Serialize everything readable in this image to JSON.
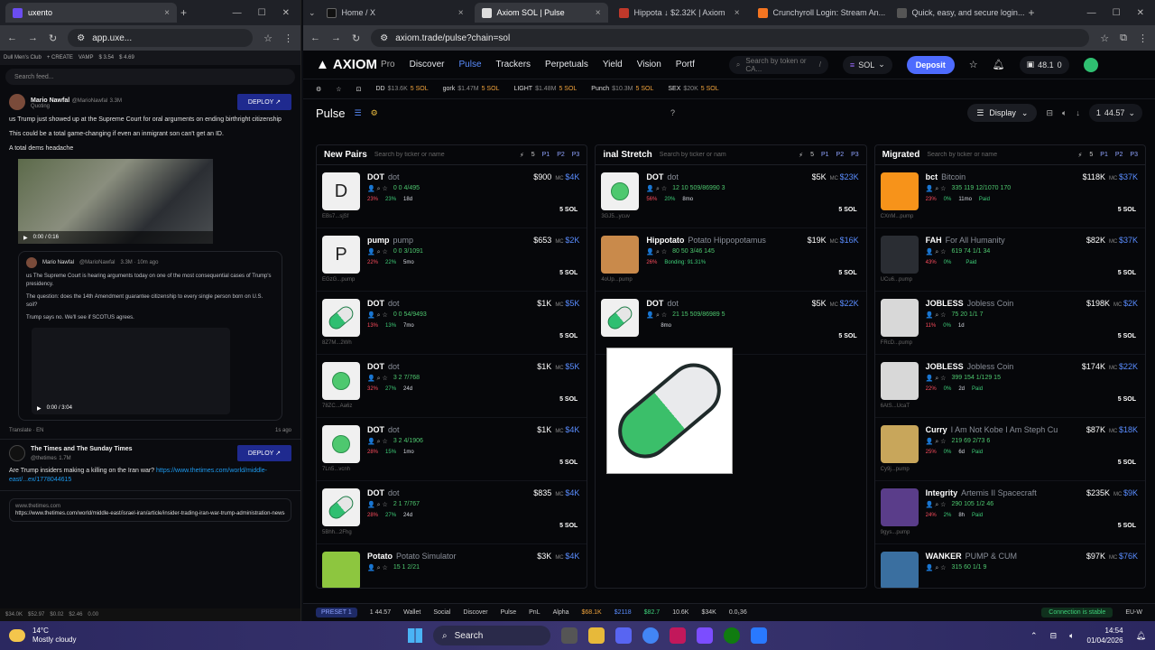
{
  "left_window": {
    "tab_title": "uxento",
    "address": "app.uxe...",
    "search_placeholder": "Search feed...",
    "toolbar_items": [
      "Dull Men's Club",
      "+ CREATE",
      "VAMP",
      "$ 3.54",
      "$ 4.69"
    ],
    "posts": [
      {
        "author": "Mario Nawfal",
        "handle": "@MarioNawfal",
        "meta": "3.3M",
        "sub": "Quoting",
        "deploy_label": "DEPLOY",
        "text": "us Trump just showed up at the Supreme Court for oral arguments on ending birthright citizenship",
        "text2": "This could be a total game-changing if even an inmigrant son can't get an ID.",
        "text3": "A total dems headache",
        "video_time": "0:00 / 0:16",
        "quote": {
          "author": "Mario Nawfal",
          "handle": "@MarioNawfal",
          "meta": "3.3M · 10m ago",
          "text1": "us The Supreme Court is hearing arguments today on one of the most consequential cases of Trump's presidency.",
          "text2": "The question: does the 14th Amendment guarantee citizenship to every single person born on U.S. soil?",
          "text3": "Trump says no. We'll see if SCOTUS agrees.",
          "video_time": "0:00 / 3:04"
        },
        "translate": "Translate · EN",
        "ago": "1s ago"
      },
      {
        "author": "The Times and The Sunday Times",
        "handle": "@thetimes",
        "meta": "1.7M",
        "deploy_label": "DEPLOY",
        "text": "Are Trump insiders making a killing on the Iran war?",
        "link": "https://www.thetimes.com/world/middle-east/...ex/1778044615",
        "card_domain": "www.thetimes.com",
        "card_url": "https://www.thetimes.com/world/middle-east/israel-iran/article/insider-trading-iran-war-trump-administration-news-7rn3tpjw?..."
      }
    ],
    "status": [
      "$34.0K",
      "$52.97",
      "$0.02",
      "$2.46",
      "0.00"
    ]
  },
  "right_window": {
    "tabs": [
      {
        "title": "Home / X",
        "color": "#111111"
      },
      {
        "title": "Axiom SOL | Pulse",
        "color": "#222222",
        "active": true
      },
      {
        "title": "Hippota ↓ $2.32K | Axiom",
        "color": "#c0392b"
      },
      {
        "title": "Crunchyroll Login: Stream An...",
        "color": "#f47521"
      },
      {
        "title": "Quick, easy, and secure login...",
        "color": "#555555"
      }
    ],
    "address": "axiom.trade/pulse?chain=sol",
    "nav": {
      "logo": "AXIOM",
      "logo_sub": "Pro",
      "items": [
        "Discover",
        "Pulse",
        "Trackers",
        "Perpetuals",
        "Yield",
        "Vision",
        "Portf"
      ],
      "search_placeholder": "Search by token or CA...",
      "search_key": "/",
      "chain": "SOL",
      "deposit": "Deposit",
      "balance": "48.1",
      "count": "0"
    },
    "ticker": [
      {
        "sym": "DD",
        "cap": "$13.6K",
        "amt": "5 SOL"
      },
      {
        "sym": "gork",
        "cap": "$1.47M",
        "amt": "5 SOL"
      },
      {
        "sym": "LIGHT",
        "cap": "$1.48M",
        "amt": "5 SOL"
      },
      {
        "sym": "Punch",
        "cap": "$10.3M",
        "amt": "5 SOL"
      },
      {
        "sym": "SEX",
        "cap": "$20K",
        "amt": "5 SOL"
      }
    ],
    "pulse_title": "Pulse",
    "display_label": "Display",
    "page_info": "1",
    "sol_amount": "44.57",
    "columns": [
      {
        "title": "New Pairs",
        "search": "Search by ticker or name",
        "count": "5",
        "rows": [
          {
            "sym": "DOT",
            "name": "dot",
            "thumb": "D",
            "id": "EBs7...sjSf",
            "vol": "$900",
            "mc": "$4K",
            "stats": "0  0  4/495",
            "p1": "23%",
            "p2": "23%",
            "age": "18d",
            "sol": "5 SOL"
          },
          {
            "sym": "pump",
            "name": "pump",
            "thumb": "P",
            "id": "EGzG...pump",
            "vol": "$653",
            "mc": "$2K",
            "stats": "0  0  3/1091",
            "p1": "22%",
            "p2": "22%",
            "age": "5mo",
            "sol": "5 SOL"
          },
          {
            "sym": "DOT",
            "name": "dot",
            "thumb": "pill",
            "id": "8Z7M...2Wh",
            "vol": "$1K",
            "mc": "$5K",
            "stats": "0  0  54/9493",
            "p1": "13%",
            "p2": "13%",
            "age": "7mo",
            "sol": "5 SOL"
          },
          {
            "sym": "DOT",
            "name": "dot",
            "thumb": "circle",
            "id": "78ZC...Aa6z",
            "vol": "$1K",
            "mc": "$5K",
            "stats": "3  2  7/768",
            "p1": "32%",
            "p2": "27%",
            "age": "24d",
            "sol": "5 SOL"
          },
          {
            "sym": "DOT",
            "name": "dot",
            "thumb": "circle",
            "id": "7Ln5...vcnh",
            "vol": "$1K",
            "mc": "$4K",
            "stats": "3  2  4/1906",
            "p1": "28%",
            "p2": "15%",
            "age": "1mo",
            "sol": "5 SOL"
          },
          {
            "sym": "DOT",
            "name": "dot",
            "thumb": "pill",
            "id": "5Bhh...2Fhg",
            "vol": "$835",
            "mc": "$4K",
            "stats": "2  1  7/767",
            "p1": "28%",
            "p2": "27%",
            "age": "24d",
            "sol": "5 SOL"
          },
          {
            "sym": "Potato",
            "name": "Potato Simulator",
            "thumb": "potato",
            "id": "",
            "vol": "$3K",
            "mc": "$4K",
            "stats": "15  1  2/21",
            "p1": "",
            "p2": "",
            "age": "",
            "sol": ""
          }
        ]
      },
      {
        "title": "inal Stretch",
        "search": "Search by ticker or nam",
        "count": "5",
        "rows": [
          {
            "sym": "DOT",
            "name": "dot",
            "thumb": "circle",
            "id": "3GJ5...ycuv",
            "vol": "$5K",
            "mc": "$23K",
            "stats": "12  10  509/86990  3",
            "p1": "56%",
            "p2": "20%",
            "age": "8mo",
            "sol": "5 SOL"
          },
          {
            "sym": "Hippotato",
            "name": "Potato Hippopotamus",
            "thumb": "hippo",
            "id": "4oUp...pump",
            "vol": "$19K",
            "mc": "$16K",
            "stats": "80  50  3/46  145",
            "p1": "26%",
            "p2": "Bonding: 91.31%",
            "age": "",
            "sol": "5 SOL"
          },
          {
            "sym": "DOT",
            "name": "dot",
            "thumb": "pill",
            "id": "",
            "vol": "$5K",
            "mc": "$22K",
            "stats": "21  15  509/86989  5",
            "p1": "",
            "p2": "",
            "age": "8mo",
            "sol": "5 SOL"
          }
        ]
      },
      {
        "title": "Migrated",
        "search": "Search by ticker or name",
        "count": "5",
        "rows": [
          {
            "sym": "bct",
            "name": "Bitcoin",
            "thumb": "btc",
            "id": "CXnM...pump",
            "vol": "$118K",
            "mc": "$37K",
            "stats": "335  119  12/1070  170",
            "p1": "23%",
            "p2": "0%",
            "age": "11mo",
            "paid": "Paid",
            "sol": "5 SOL"
          },
          {
            "sym": "FAH",
            "name": "For All Humanity",
            "thumb": "fah",
            "id": "UCu6...pump",
            "vol": "$82K",
            "mc": "$37K",
            "stats": "619  74  1/1  34",
            "p1": "43%",
            "p2": "0%",
            "age": "",
            "paid": "Paid",
            "sol": "5 SOL"
          },
          {
            "sym": "JOBLESS",
            "name": "Jobless Coin",
            "thumb": "jobless",
            "id": "FRcD...pump",
            "vol": "$198K",
            "mc": "$2K",
            "stats": "75  20  1/1  7",
            "p1": "11%",
            "p2": "0%",
            "age": "1d",
            "paid": "",
            "sol": "5 SOL"
          },
          {
            "sym": "JOBLESS",
            "name": "Jobless Coin",
            "thumb": "jobless",
            "id": "6AtS...UcaT",
            "vol": "$174K",
            "mc": "$22K",
            "stats": "399  154  1/129  15",
            "p1": "22%",
            "p2": "0%",
            "age": "2d",
            "paid": "Paid",
            "sol": "5 SOL"
          },
          {
            "sym": "Curry",
            "name": "I Am Not Kobe I Am Steph Cu",
            "thumb": "curry",
            "id": "Cy9j...pump",
            "vol": "$87K",
            "mc": "$18K",
            "stats": "219  69  2/73  6",
            "p1": "25%",
            "p2": "0%",
            "age": "6d",
            "paid": "Paid",
            "sol": "5 SOL"
          },
          {
            "sym": "Integrity",
            "name": "Artemis II Spacecraft",
            "thumb": "integ",
            "id": "9gys...pump",
            "vol": "$235K",
            "mc": "$9K",
            "stats": "290  105  1/2  46",
            "p1": "24%",
            "p2": "2%",
            "age": "8h",
            "paid": "Paid",
            "sol": "5 SOL"
          },
          {
            "sym": "WANKER",
            "name": "PUMP & CUM",
            "thumb": "wanker",
            "id": "",
            "vol": "$97K",
            "mc": "$76K",
            "stats": "315  60  1/1  9",
            "p1": "",
            "p2": "",
            "age": "",
            "paid": "",
            "sol": ""
          }
        ]
      }
    ],
    "statusbar": {
      "preset": "PRESET 1",
      "page": "1",
      "sol": "44.57",
      "items": [
        "Wallet",
        "Social",
        "Discover",
        "Pulse",
        "PnL",
        "Alpha"
      ],
      "prices": [
        "$68.1K",
        "$2118",
        "$82.7",
        "10.6K",
        "$34K",
        "0.0₁36"
      ],
      "connection": "Connection is stable",
      "region": "EU-W"
    }
  },
  "taskbar": {
    "weather_temp": "14°C",
    "weather_desc": "Mostly cloudy",
    "search": "Search",
    "time": "14:54",
    "date": "01/04/2026"
  }
}
